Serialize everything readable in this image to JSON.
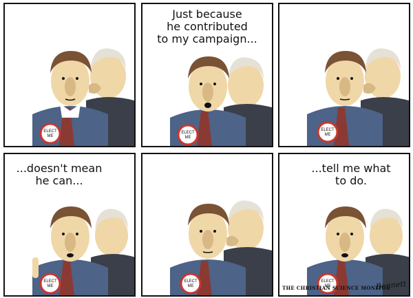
{
  "panels": [
    {
      "caption": ""
    },
    {
      "caption": "Just because\nhe contributed\nto my campaign..."
    },
    {
      "caption": ""
    },
    {
      "caption": "...doesn't mean\nhe can..."
    },
    {
      "caption": ""
    },
    {
      "caption": "...tell me what\nto do."
    }
  ],
  "button_text": "ELECT\nME",
  "credit": "THE CHRISTIAN SCIENCE MONITOR",
  "signature": "Bennett",
  "colors": {
    "suit": "#4d6388",
    "suit_dark": "#2f4166",
    "skin": "#efd7a8",
    "skin_shade": "#d8b884",
    "hair": "#7a5234",
    "tie": "#8a3a32",
    "old_hair": "#e6e1d6",
    "old_suit": "#3a3f4a",
    "button_red": "#c8372f"
  }
}
